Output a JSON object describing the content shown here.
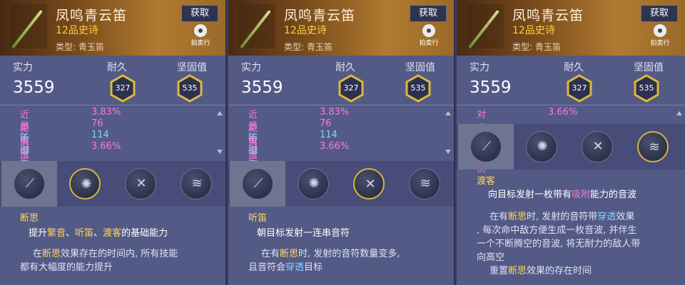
{
  "panels": [
    {
      "name": "凤鸣青云笛",
      "grade": "12品史诗",
      "type": "类型:  青玉笛",
      "get_label": "获取",
      "auction_label": "拍卖行",
      "stat_labels": {
        "power": "实力",
        "durability": "耐久",
        "firmness": "坚固值"
      },
      "power": "3559",
      "durability": "327",
      "firmness": "535",
      "attributes": [
        {
          "name": "近距离增伤",
          "value": "3.83%"
        },
        {
          "name": "暴击",
          "value": "76"
        },
        {
          "name": "防御穿透",
          "value": "114"
        },
        {
          "name": "对玩家增伤",
          "value": "3.66%"
        }
      ],
      "skill_icons": [
        "flute-blade-icon",
        "tornado-icon",
        "flute-cross-icon",
        "sound-wave-icon"
      ],
      "skill_title": "断思",
      "skill_line": {
        "a": "提升",
        "b": "繁音",
        "c": "、",
        "d": "听笛",
        "e": "、",
        "f": "渡客",
        "g": "的基础能力"
      },
      "skill_desc": {
        "a": "在",
        "b": "断思",
        "c": "效果存在的时间内, 所有技能",
        "d": "都有大幅度的能力提升"
      }
    },
    {
      "name": "凤鸣青云笛",
      "grade": "12品史诗",
      "type": "类型:  青玉笛",
      "get_label": "获取",
      "auction_label": "拍卖行",
      "stat_labels": {
        "power": "实力",
        "durability": "耐久",
        "firmness": "坚固值"
      },
      "power": "3559",
      "durability": "327",
      "firmness": "535",
      "attributes": [
        {
          "name": "近距离增伤",
          "value": "3.83%"
        },
        {
          "name": "暴击",
          "value": "76"
        },
        {
          "name": "防御穿透",
          "value": "114"
        },
        {
          "name": "对玩家增伤",
          "value": "3.66%"
        }
      ],
      "skill_title": "听笛",
      "skill_line": "朝目标发射一连串音符",
      "skill_desc": {
        "a": "在有",
        "b": "断思",
        "c": "时, 发射的音符数量变多,",
        "d": "且音符会",
        "e": "穿透",
        "f": "目标"
      }
    },
    {
      "name": "凤鸣青云笛",
      "grade": "12品史诗",
      "type": "类型:  青玉笛",
      "get_label": "获取",
      "auction_label": "拍卖行",
      "stat_labels": {
        "power": "实力",
        "durability": "耐久",
        "firmness": "坚固值"
      },
      "power": "3559",
      "durability": "327",
      "firmness": "535",
      "attributes": [
        {
          "name": "对玩家增伤",
          "value": "3.66%"
        }
      ],
      "skill_title": "渡客",
      "skill_line": {
        "a": "向目标发射一枚带有",
        "b": "吸附",
        "c": "能力的音波"
      },
      "skill_desc": {
        "a": "在有",
        "b": "断思",
        "c": "时, 发射的音符带",
        "d": "穿透",
        "e": "效果",
        "f": ", 每次命中敌方便生成一枚音波, 并伴生",
        "g": "一个不断腾空的音波, 将无耐力的敌人带",
        "h": "向高空",
        "i": "重置",
        "j": "断思",
        "k": "效果的存在时间"
      }
    }
  ]
}
